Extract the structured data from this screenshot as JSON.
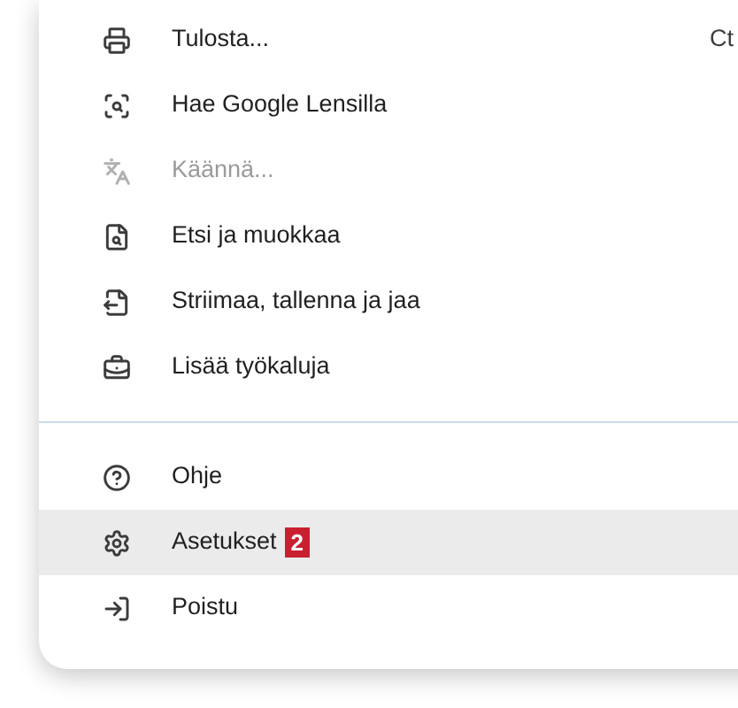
{
  "menu_groups": [
    {
      "items": [
        {
          "label": "Tulosta...",
          "shortcut": "Ct",
          "disabled": false,
          "selected": false
        },
        {
          "label": "Hae Google Lensilla",
          "disabled": false,
          "selected": false
        },
        {
          "label": "Käännä...",
          "disabled": true,
          "selected": false
        },
        {
          "label": "Etsi ja muokkaa",
          "disabled": false,
          "selected": false
        },
        {
          "label": "Striimaa, tallenna ja jaa",
          "disabled": false,
          "selected": false
        },
        {
          "label": "Lisää työkaluja",
          "disabled": false,
          "selected": false
        }
      ]
    },
    {
      "items": [
        {
          "label": "Ohje",
          "disabled": false,
          "selected": false
        },
        {
          "label": "Asetukset",
          "badge": "2",
          "disabled": false,
          "selected": true
        },
        {
          "label": "Poistu",
          "disabled": false,
          "selected": false
        }
      ]
    }
  ]
}
